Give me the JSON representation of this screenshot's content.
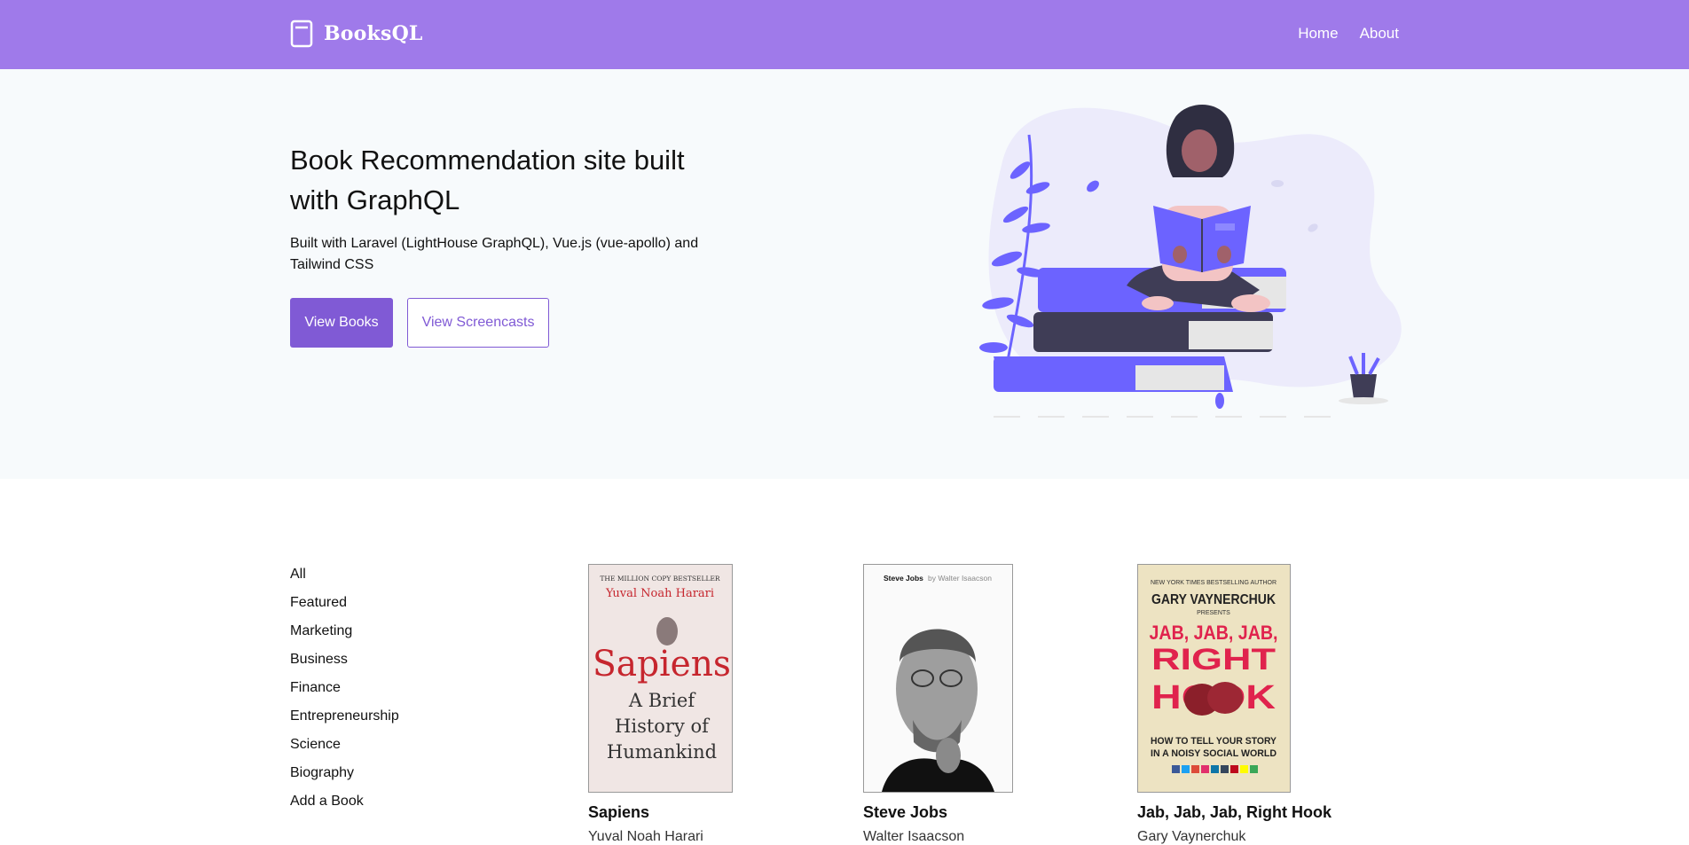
{
  "nav": {
    "brand": "BooksQL",
    "links": [
      "Home",
      "About"
    ]
  },
  "hero": {
    "title": "Book Recommendation site built with GraphQL",
    "subtitle": "Built with Laravel (LightHouse GraphQL), Vue.js (vue-apollo) and Tailwind CSS",
    "primary_button": "View Books",
    "secondary_button": "View Screencasts"
  },
  "categories": [
    "All",
    "Featured",
    "Marketing",
    "Business",
    "Finance",
    "Entrepreneurship",
    "Science",
    "Biography",
    "Add a Book"
  ],
  "books": [
    {
      "title": "Sapiens",
      "author": "Yuval Noah Harari",
      "cover": {
        "tagline": "THE MILLION COPY BESTSELLER",
        "author": "Yuval Noah Harari",
        "title": "Sapiens",
        "subtitle_lines": [
          "A Brief",
          "History of",
          "Humankind"
        ]
      }
    },
    {
      "title": "Steve Jobs",
      "author": "Walter Isaacson",
      "cover": {
        "title": "Steve Jobs",
        "byline": "by Walter Isaacson"
      }
    },
    {
      "title": "Jab, Jab, Jab, Right Hook",
      "author": "Gary Vaynerchuk",
      "cover": {
        "tagline": "NEW YORK TIMES BESTSELLING AUTHOR",
        "author": "GARY VAYNERCHUK",
        "presents": "PRESENTS",
        "title_lines": [
          "JAB, JAB, JAB,",
          "RIGHT",
          "HOOK"
        ],
        "subtitle_lines": [
          "HOW TO TELL YOUR STORY",
          "IN A NOISY SOCIAL WORLD"
        ]
      }
    }
  ],
  "colors": {
    "nav_bg": "#9f7aea",
    "primary": "#805ad5",
    "hero_bg": "#f7fafc",
    "illustration_accent": "#6c63ff"
  },
  "icons": {
    "brand": "book-icon"
  }
}
